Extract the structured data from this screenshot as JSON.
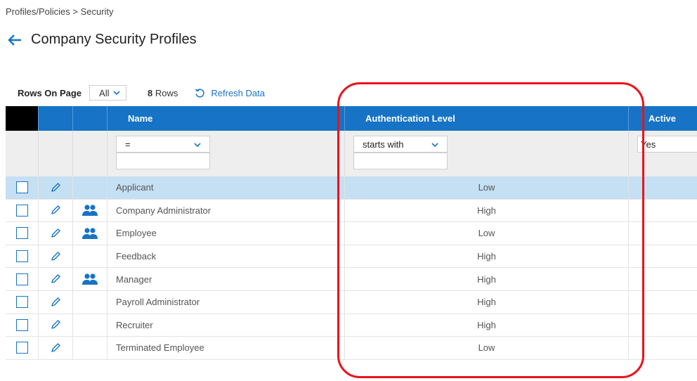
{
  "breadcrumb": "Profiles/Policies > Security",
  "page": {
    "title": "Company Security Profiles"
  },
  "toolbar": {
    "rows_on_page_label": "Rows On Page",
    "rows_on_page_value": "All",
    "row_count": "8",
    "row_count_suffix": " Rows",
    "refresh_label": "Refresh Data"
  },
  "columns": {
    "name": "Name",
    "auth": "Authentication Level",
    "active": "Active"
  },
  "filters": {
    "name_op": "=",
    "auth_op": "starts with",
    "active_value": "Yes"
  },
  "rows": [
    {
      "name": "Applicant",
      "auth": "Low",
      "group": false
    },
    {
      "name": "Company Administrator",
      "auth": "High",
      "group": true
    },
    {
      "name": "Employee",
      "auth": "Low",
      "group": true
    },
    {
      "name": "Feedback",
      "auth": "High",
      "group": false
    },
    {
      "name": "Manager",
      "auth": "High",
      "group": true
    },
    {
      "name": "Payroll Administrator",
      "auth": "High",
      "group": false
    },
    {
      "name": "Recruiter",
      "auth": "High",
      "group": false
    },
    {
      "name": "Terminated Employee",
      "auth": "Low",
      "group": false
    }
  ],
  "colors": {
    "header_blue": "#1673c6",
    "selected_row": "#c5dff3",
    "link_blue": "#1a73c9",
    "highlight_red": "#e8141b"
  },
  "icons": {
    "back": "arrow-left-icon",
    "refresh": "refresh-icon",
    "edit": "pencil-icon",
    "group": "people-icon",
    "dropdown": "chevron-down-icon"
  }
}
